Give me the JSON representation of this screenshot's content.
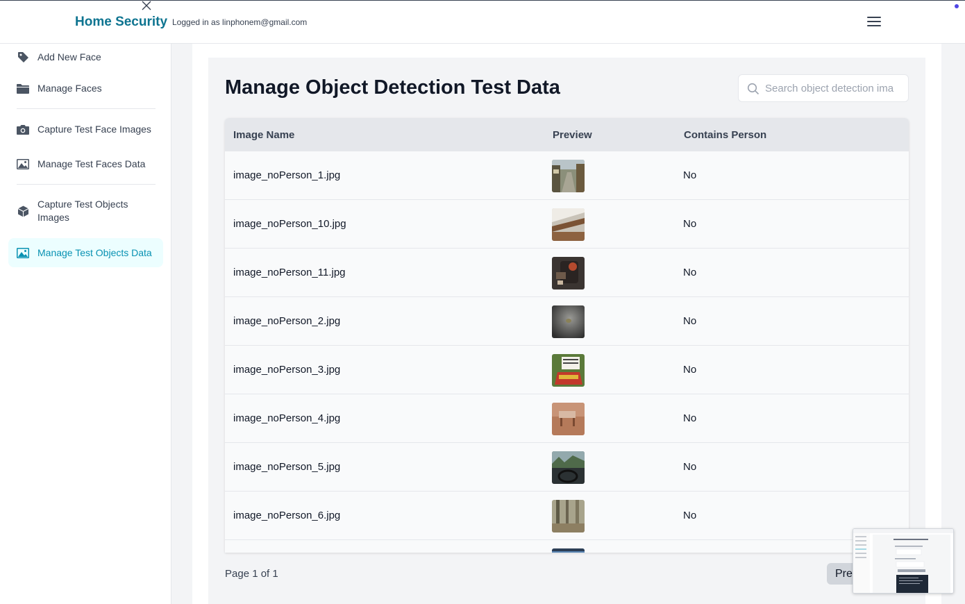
{
  "header": {
    "brand": "Home Security",
    "login_note": "Logged in as linphonem@gmail.com"
  },
  "sidebar": {
    "items": [
      {
        "label": "Add New Face",
        "icon": "tag-icon"
      },
      {
        "label": "Manage Faces",
        "icon": "folder-icon"
      },
      {
        "label": "Capture Test Face Images",
        "icon": "camera-icon"
      },
      {
        "label": "Manage Test Faces Data",
        "icon": "image-icon"
      },
      {
        "label": "Capture Test Objects Images",
        "icon": "cube-icon"
      },
      {
        "label": "Manage Test Objects Data",
        "icon": "image-icon",
        "active": true
      }
    ]
  },
  "main": {
    "title": "Manage Object Detection Test Data",
    "search_placeholder": "Search object detection ima",
    "columns": [
      "Image Name",
      "Preview",
      "Contains Person"
    ],
    "rows": [
      {
        "name": "image_noPerson_1.jpg",
        "person": "No"
      },
      {
        "name": "image_noPerson_10.jpg",
        "person": "No"
      },
      {
        "name": "image_noPerson_11.jpg",
        "person": "No"
      },
      {
        "name": "image_noPerson_2.jpg",
        "person": "No"
      },
      {
        "name": "image_noPerson_3.jpg",
        "person": "No"
      },
      {
        "name": "image_noPerson_4.jpg",
        "person": "No"
      },
      {
        "name": "image_noPerson_5.jpg",
        "person": "No"
      },
      {
        "name": "image_noPerson_6.jpg",
        "person": "No"
      }
    ],
    "pagination": {
      "page_text": "Page 1 of 1",
      "prev_label": "Pre"
    }
  },
  "colors": {
    "brand": "#0e7490",
    "active": "#0891b2"
  }
}
